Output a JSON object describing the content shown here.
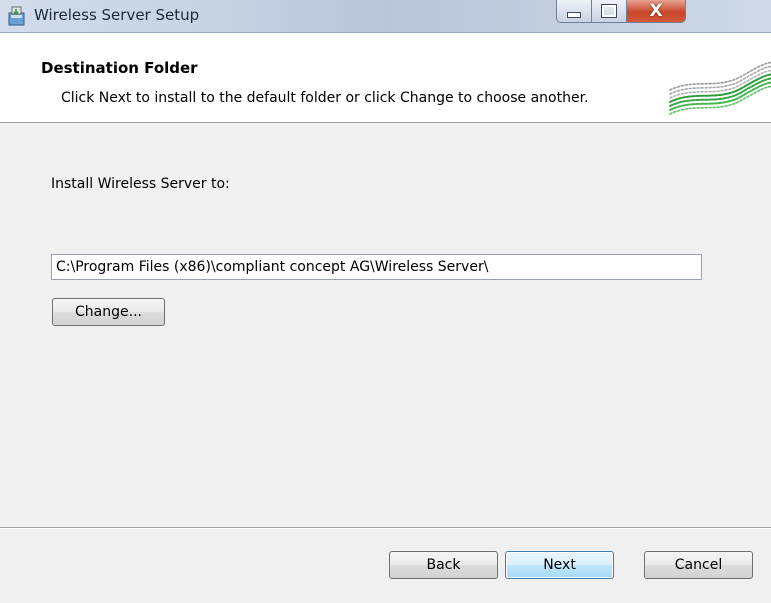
{
  "window": {
    "title": "Wireless Server Setup",
    "close_symbol": "X"
  },
  "header": {
    "title": "Destination Folder",
    "subtitle": "Click Next to install to the default folder or click Change to choose another."
  },
  "main": {
    "install_label": "Install Wireless Server to:",
    "install_path": "C:\\Program Files (x86)\\compliant concept AG\\Wireless Server\\",
    "change_label": "Change..."
  },
  "footer": {
    "back_label": "Back",
    "next_label": "Next",
    "cancel_label": "Cancel"
  },
  "icons": {
    "app": "installer-icon",
    "minimize": "minimize-icon",
    "maximize": "maximize-icon",
    "close": "close-icon",
    "logo": "wave-logo"
  },
  "colors": {
    "logo_green": "#2e9a3a",
    "logo_gray": "#9a9a9a",
    "close_red": "#c7472a",
    "default_button_border": "#3c7fb1"
  }
}
